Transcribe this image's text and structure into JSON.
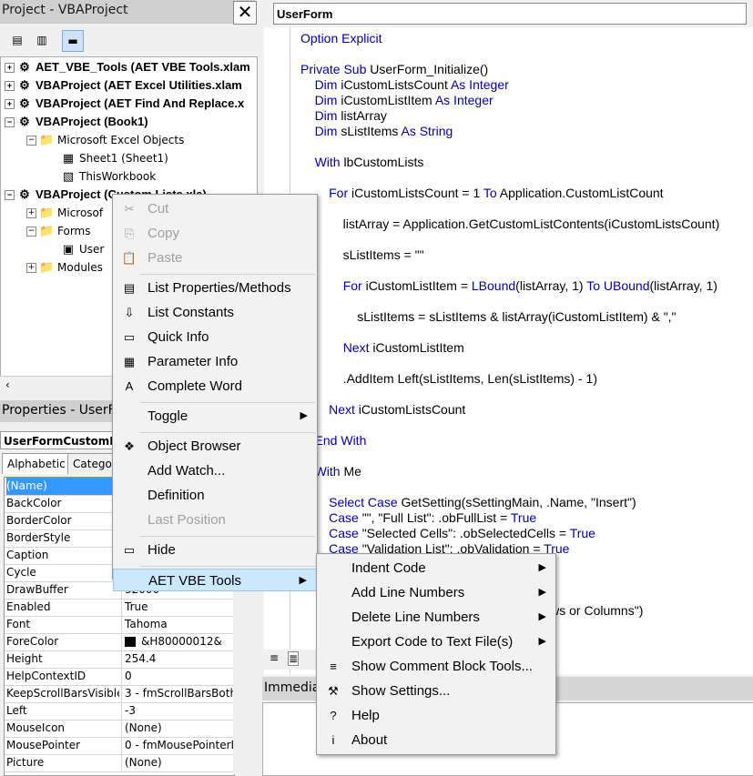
{
  "project": {
    "title": "Project - VBAProject",
    "close": "✕",
    "nodes": [
      {
        "label": "AET_VBE_Tools (AET VBE Tools.xlam",
        "bold": true,
        "exp": "+"
      },
      {
        "label": "VBAProject (AET Excel Utilities.xlam",
        "bold": true,
        "exp": "+"
      },
      {
        "label": "VBAProject (AET Find And Replace.x",
        "bold": true,
        "exp": "+"
      },
      {
        "label": "VBAProject (Book1)",
        "bold": true,
        "exp": "−"
      },
      {
        "label": "Microsoft Excel Objects",
        "bold": false,
        "exp": "−"
      },
      {
        "label": "Sheet1 (Sheet1)",
        "bold": false,
        "exp": ""
      },
      {
        "label": "ThisWorkbook",
        "bold": false,
        "exp": ""
      },
      {
        "label": "VBAProject (Custom Lists.xla)",
        "bold": true,
        "exp": "−"
      },
      {
        "label": "Microsof",
        "bold": false,
        "exp": "+"
      },
      {
        "label": "Forms",
        "bold": false,
        "exp": "−"
      },
      {
        "label": "User",
        "bold": false,
        "exp": ""
      },
      {
        "label": "Modules",
        "bold": false,
        "exp": "+"
      }
    ]
  },
  "properties": {
    "title": "Properties - UserFo",
    "object": "UserFormCustomLi",
    "tabs": [
      "Alphabetic",
      "Categor"
    ],
    "rows": [
      {
        "name": "(Name)",
        "value": ""
      },
      {
        "name": "BackColor",
        "value": ""
      },
      {
        "name": "BorderColor",
        "value": ""
      },
      {
        "name": "BorderStyle",
        "value": ""
      },
      {
        "name": "Caption",
        "value": ""
      },
      {
        "name": "Cycle",
        "value": ""
      },
      {
        "name": "DrawBuffer",
        "value": "32000"
      },
      {
        "name": "Enabled",
        "value": "True"
      },
      {
        "name": "Font",
        "value": "Tahoma"
      },
      {
        "name": "ForeColor",
        "value": "&H80000012&"
      },
      {
        "name": "Height",
        "value": "254.4"
      },
      {
        "name": "HelpContextID",
        "value": "0"
      },
      {
        "name": "KeepScrollBarsVisible",
        "value": "3 - fmScrollBarsBoth"
      },
      {
        "name": "Left",
        "value": "-3"
      },
      {
        "name": "MouseIcon",
        "value": "(None)"
      },
      {
        "name": "MousePointer",
        "value": "0 - fmMousePointerD"
      },
      {
        "name": "Picture",
        "value": "(None)"
      }
    ]
  },
  "code": {
    "object_combo": "UserForm",
    "lines": [
      "Option Explicit",
      "",
      "Private Sub UserForm_Initialize()",
      "    Dim iCustomListsCount As Integer",
      "    Dim iCustomListItem As Integer",
      "    Dim listArray",
      "    Dim sListItems As String",
      "",
      "    With lbCustomLists",
      "",
      "        For iCustomListsCount = 1 To Application.CustomListCount",
      "",
      "            listArray = Application.GetCustomListContents(iCustomListsCount)",
      "",
      "            sListItems = \"\"",
      "",
      "            For iCustomListItem = LBound(listArray, 1) To UBound(listArray, 1)",
      "",
      "                sListItems = sListItems & listArray(iCustomListItem) & \",\"",
      "",
      "            Next iCustomListItem",
      "",
      "            .AddItem Left(sListItems, Len(sListItems) - 1)",
      "",
      "        Next iCustomListsCount",
      "",
      "    End With",
      "",
      "    With Me",
      "",
      "        Select Case GetSetting(sSettingMain, .Name, \"Insert\")",
      "        Case \"\", \"Full List\": .obFullList = True",
      "        Case \"Selected Cells\": .obSelectedCells = True",
      "        Case \"Validation List\": .obValidation = True",
      "",
      "",
      "",
      "                                                    .Name, \"Rows or Columns\")"
    ]
  },
  "immediate": {
    "title": "Immedia"
  },
  "context_menu": {
    "items": [
      {
        "label": "Cut",
        "icon": "✂",
        "disabled": true
      },
      {
        "label": "Copy",
        "icon": "⎘",
        "disabled": true
      },
      {
        "label": "Paste",
        "icon": "📋",
        "disabled": true
      },
      {
        "sep": true
      },
      {
        "label": "List Properties/Methods",
        "icon": "▤"
      },
      {
        "label": "List Constants",
        "icon": "⇩"
      },
      {
        "label": "Quick Info",
        "icon": "▭"
      },
      {
        "label": "Parameter Info",
        "icon": "▦"
      },
      {
        "label": "Complete Word",
        "icon": "A"
      },
      {
        "sep": true
      },
      {
        "label": "Toggle",
        "submenu": true
      },
      {
        "sep": true
      },
      {
        "label": "Object Browser",
        "icon": "❖"
      },
      {
        "label": "Add Watch...",
        "icon": ""
      },
      {
        "label": "Definition",
        "icon": ""
      },
      {
        "label": "Last Position",
        "icon": "",
        "disabled": true
      },
      {
        "sep": true
      },
      {
        "label": "Hide",
        "icon": "▭"
      },
      {
        "sep": true
      },
      {
        "label": "AET VBE Tools",
        "submenu": true,
        "highlighted": true
      }
    ]
  },
  "submenu": {
    "items": [
      {
        "label": "Indent Code",
        "submenu": true
      },
      {
        "label": "Add Line Numbers",
        "submenu": true
      },
      {
        "label": "Delete Line Numbers",
        "submenu": true
      },
      {
        "label": "Export Code to Text File(s)",
        "submenu": true
      },
      {
        "label": "Show Comment Block Tools...",
        "icon": "≡"
      },
      {
        "label": "Show Settings...",
        "icon": "⚒"
      },
      {
        "label": "Help",
        "icon": "?"
      },
      {
        "label": "About",
        "icon": "i"
      }
    ]
  },
  "colors": {
    "keyword": "#0000a0",
    "selection": "#3399ff",
    "menu_highlight": "#cce8ff"
  }
}
